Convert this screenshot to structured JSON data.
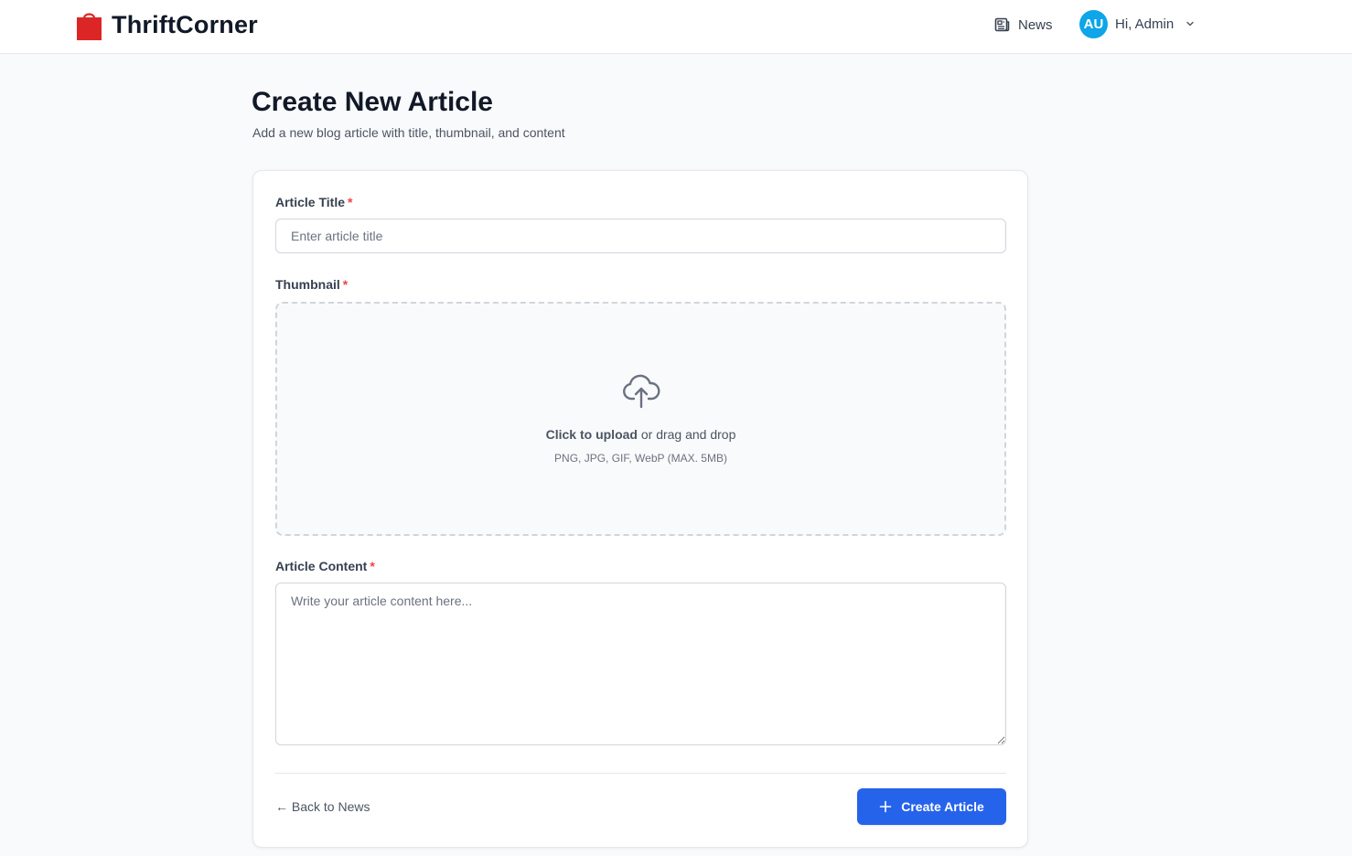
{
  "brand": {
    "name": "ThriftCorner",
    "icon": "shopping-bag-icon",
    "color": "#dc2626"
  },
  "nav": {
    "news_label": "News",
    "news_icon": "newspaper-icon",
    "avatar_initials": "AU",
    "greeting": "Hi, Admin",
    "avatar_color": "#0ea5e9"
  },
  "page": {
    "title": "Create New Article",
    "subtitle": "Add a new blog article with title, thumbnail, and content"
  },
  "form": {
    "title_label": "Article Title",
    "title_placeholder": "Enter article title",
    "title_value": "",
    "thumbnail_label": "Thumbnail",
    "upload_strong": "Click to upload",
    "upload_rest": " or drag and drop",
    "upload_hint": "PNG, JPG, GIF, WebP (MAX. 5MB)",
    "content_label": "Article Content",
    "content_placeholder": "Write your article content here...",
    "content_value": "",
    "required_mark": "*"
  },
  "actions": {
    "back_label": "← Back to News",
    "create_label": "Create Article",
    "create_icon": "plus-icon",
    "primary_color": "#2563eb"
  }
}
